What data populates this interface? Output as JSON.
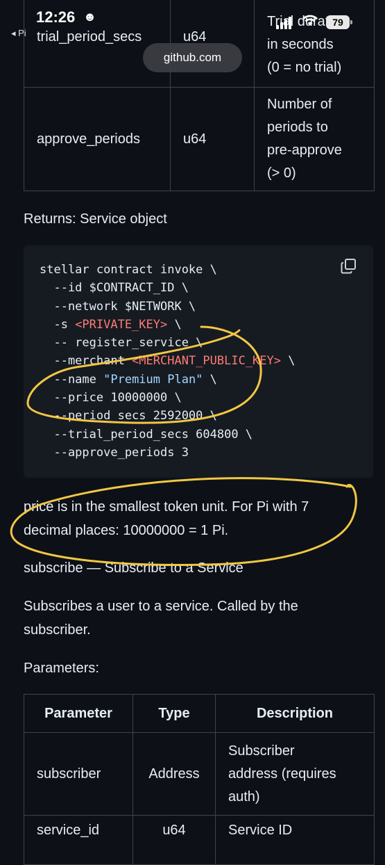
{
  "status_bar": {
    "time": "12:26",
    "back_app": "Pi",
    "battery": "79"
  },
  "browser": {
    "url": "github.com"
  },
  "top_table": {
    "rows": [
      {
        "param": "trial_period_secs",
        "type": "u64",
        "desc_lines": [
          "Trial duration",
          "in seconds",
          "(0 = no trial)"
        ]
      },
      {
        "param": "approve_periods",
        "type": "u64",
        "desc_lines": [
          "Number of",
          "periods to",
          "pre-approve",
          "(> 0)"
        ]
      }
    ]
  },
  "returns_text": "Returns: Service object",
  "code": {
    "line1": "stellar contract invoke \\",
    "line2": "  --id $CONTRACT_ID \\",
    "line3": "  --network $NETWORK \\",
    "line4a": "  -s ",
    "line4b": "<PRIVATE_KEY>",
    "line4c": " \\",
    "line5": "  -- register_service \\",
    "line6a": "  --merchant ",
    "line6b": "<MERCHANT_PUBLIC_KEY>",
    "line6c": " \\",
    "line7a": "  --name ",
    "line7b": "\"Premium Plan\"",
    "line7c": " \\",
    "line8": "  --price 10000000 \\",
    "line9": "  --period_secs 2592000 \\",
    "line10": "  --trial_period_secs 604800 \\",
    "line11": "  --approve_periods 3"
  },
  "price_note_line1": "price is in the smallest token unit. For Pi with 7",
  "price_note_line2": "decimal places: 10000000 = 1 Pi.",
  "subscribe_heading": "subscribe — Subscribe to a Service",
  "subscribe_desc_line1": "Subscribes a user to a service. Called by the",
  "subscribe_desc_line2": "subscriber.",
  "parameters_label": "Parameters:",
  "params_table": {
    "headers": [
      "Parameter",
      "Type",
      "Description"
    ],
    "rows": [
      {
        "param": "subscriber",
        "type": "Address",
        "desc_lines": [
          "Subscriber",
          "address (requires",
          "auth)"
        ]
      },
      {
        "param": "service_id",
        "type": "u64",
        "desc_lines": [
          "Service ID"
        ]
      }
    ]
  },
  "colors": {
    "background": "#0d1117",
    "code_bg": "#161b22",
    "annotation": "#f2c744",
    "string": "#a5d6ff",
    "placeholder": "#ff7b72"
  }
}
